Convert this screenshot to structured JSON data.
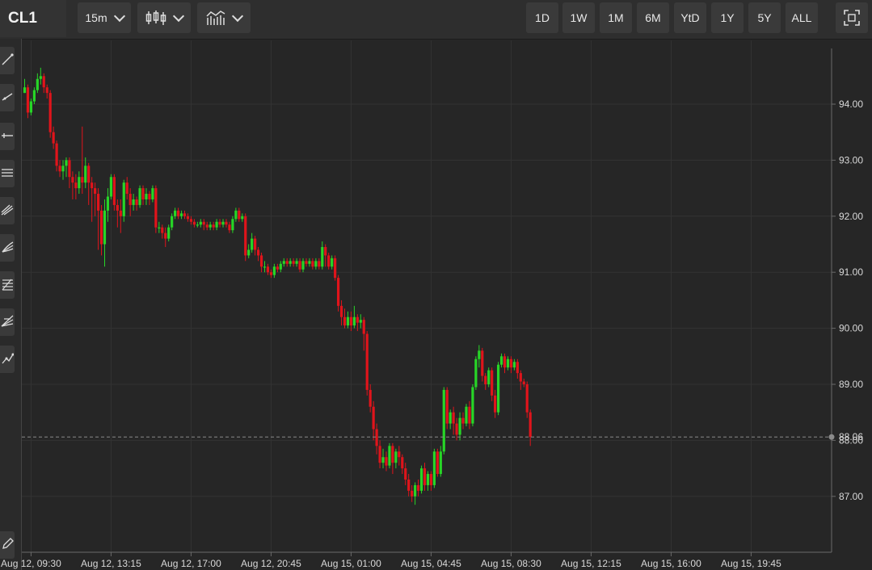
{
  "header": {
    "symbol": "CL1",
    "interval": "15m",
    "chart_type_icon": "candlestick-icon",
    "indicators_icon": "indicators-icon",
    "ranges": [
      "1D",
      "1W",
      "1M",
      "6M",
      "YtD",
      "1Y",
      "5Y",
      "ALL"
    ],
    "fullscreen_icon": "fullscreen-icon"
  },
  "sidebar": {
    "tools": [
      "trendline-icon",
      "ray-icon",
      "horizontal-line-icon",
      "parallel-channel-icon",
      "pitchfork-icon",
      "fan-icon",
      "fibonacci-icon",
      "gann-icon",
      "path-icon"
    ],
    "bottom_tool": "pencil-icon"
  },
  "price_label": "88.06",
  "colors": {
    "up": "#27d627",
    "down": "#e0141b",
    "background": "#262626",
    "grid": "#333333"
  },
  "chart_data": {
    "type": "candlestick",
    "title": "",
    "ylim": [
      86.0,
      94.95
    ],
    "y_ticks": [
      "94.00",
      "93.00",
      "92.00",
      "91.00",
      "90.00",
      "89.00",
      "88.00",
      "87.00"
    ],
    "x_ticks": [
      "Aug 12, 09:30",
      "Aug 12, 13:15",
      "Aug 12, 17:00",
      "Aug 12, 20:45",
      "Aug 15, 01:00",
      "Aug 15, 04:45",
      "Aug 15, 08:30",
      "Aug 15, 12:15",
      "Aug 15, 16:00",
      "Aug 15, 19:45"
    ],
    "x_tick_positions": [
      2,
      27,
      52,
      77,
      102,
      127,
      152,
      177,
      202,
      227
    ],
    "last_price": 88.06,
    "last_price_label": "88.06",
    "candles": [
      [
        94.2,
        94.3,
        94.45,
        94.2
      ],
      [
        94.3,
        93.85,
        94.35,
        93.75
      ],
      [
        93.85,
        94.05,
        94.1,
        93.8
      ],
      [
        94.05,
        94.25,
        94.3,
        94.0
      ],
      [
        94.25,
        94.45,
        94.55,
        94.2
      ],
      [
        94.45,
        94.5,
        94.65,
        94.35
      ],
      [
        94.5,
        94.3,
        94.55,
        94.2
      ],
      [
        94.3,
        94.2,
        94.35,
        94.1
      ],
      [
        94.2,
        93.5,
        94.25,
        93.4
      ],
      [
        93.5,
        93.3,
        93.6,
        93.2
      ],
      [
        93.3,
        92.9,
        93.35,
        92.8
      ],
      [
        92.9,
        92.8,
        93.0,
        92.7
      ],
      [
        92.8,
        92.9,
        93.0,
        92.65
      ],
      [
        92.9,
        93.0,
        93.05,
        92.7
      ],
      [
        93.0,
        92.7,
        93.05,
        92.5
      ],
      [
        92.7,
        92.6,
        92.8,
        92.3
      ],
      [
        92.6,
        92.5,
        92.75,
        92.3
      ],
      [
        92.5,
        92.7,
        92.8,
        92.4
      ],
      [
        92.7,
        92.6,
        93.6,
        92.4
      ],
      [
        92.6,
        92.9,
        93.05,
        92.5
      ],
      [
        92.9,
        92.6,
        92.95,
        92.2
      ],
      [
        92.6,
        92.5,
        92.7,
        91.9
      ],
      [
        92.5,
        92.4,
        92.6,
        92.0
      ],
      [
        92.4,
        92.1,
        92.5,
        91.4
      ],
      [
        92.1,
        91.5,
        92.2,
        91.3
      ],
      [
        91.5,
        92.1,
        92.3,
        91.1
      ],
      [
        92.1,
        92.35,
        92.5,
        91.9
      ],
      [
        92.35,
        92.7,
        92.75,
        92.3
      ],
      [
        92.7,
        92.2,
        92.75,
        92.1
      ],
      [
        92.2,
        92.1,
        92.3,
        91.8
      ],
      [
        92.1,
        92.0,
        92.3,
        91.7
      ],
      [
        92.0,
        92.6,
        92.65,
        91.9
      ],
      [
        92.6,
        92.4,
        92.7,
        92.3
      ],
      [
        92.4,
        92.2,
        92.5,
        92.0
      ],
      [
        92.2,
        92.3,
        92.4,
        92.1
      ],
      [
        92.3,
        92.2,
        92.35,
        92.1
      ],
      [
        92.2,
        92.5,
        92.55,
        92.15
      ],
      [
        92.5,
        92.3,
        92.55,
        92.2
      ],
      [
        92.3,
        92.4,
        92.5,
        92.2
      ],
      [
        92.4,
        92.3,
        92.45,
        92.2
      ],
      [
        92.3,
        92.5,
        92.55,
        92.25
      ],
      [
        92.5,
        91.8,
        92.55,
        91.7
      ],
      [
        91.8,
        91.8,
        91.9,
        91.7
      ],
      [
        91.8,
        91.7,
        91.85,
        91.6
      ],
      [
        91.7,
        91.6,
        91.8,
        91.45
      ],
      [
        91.6,
        91.8,
        91.85,
        91.55
      ],
      [
        91.8,
        92.0,
        92.05,
        91.75
      ],
      [
        92.0,
        92.1,
        92.15,
        91.95
      ],
      [
        92.1,
        92.0,
        92.15,
        91.95
      ],
      [
        92.0,
        92.05,
        92.1,
        91.95
      ],
      [
        92.05,
        92.0,
        92.1,
        91.95
      ],
      [
        92.0,
        91.95,
        92.05,
        91.9
      ],
      [
        91.95,
        91.9,
        92.0,
        91.85
      ],
      [
        91.9,
        91.85,
        91.95,
        91.8
      ],
      [
        91.85,
        91.85,
        91.9,
        91.8
      ],
      [
        91.85,
        91.9,
        91.95,
        91.8
      ],
      [
        91.9,
        91.85,
        91.95,
        91.75
      ],
      [
        91.85,
        91.8,
        91.9,
        91.75
      ],
      [
        91.8,
        91.85,
        91.9,
        91.75
      ],
      [
        91.85,
        91.8,
        91.9,
        91.75
      ],
      [
        91.8,
        91.9,
        91.95,
        91.75
      ],
      [
        91.9,
        91.85,
        91.95,
        91.8
      ],
      [
        91.85,
        91.9,
        91.95,
        91.8
      ],
      [
        91.9,
        91.85,
        91.95,
        91.8
      ],
      [
        91.85,
        91.75,
        91.9,
        91.7
      ],
      [
        91.75,
        91.95,
        92.0,
        91.7
      ],
      [
        91.95,
        92.1,
        92.15,
        91.9
      ],
      [
        92.1,
        91.95,
        92.15,
        91.9
      ],
      [
        91.95,
        92.0,
        92.05,
        91.9
      ],
      [
        92.0,
        91.3,
        92.05,
        91.2
      ],
      [
        91.3,
        91.4,
        91.5,
        91.25
      ],
      [
        91.4,
        91.6,
        91.7,
        91.35
      ],
      [
        91.6,
        91.4,
        91.65,
        91.3
      ],
      [
        91.4,
        91.3,
        91.45,
        91.2
      ],
      [
        91.3,
        91.1,
        91.35,
        91.0
      ],
      [
        91.1,
        91.1,
        91.2,
        91.0
      ],
      [
        91.1,
        91.0,
        91.15,
        90.95
      ],
      [
        91.0,
        90.95,
        91.05,
        90.9
      ],
      [
        90.95,
        91.1,
        91.15,
        90.9
      ],
      [
        91.1,
        91.05,
        91.15,
        91.0
      ],
      [
        91.05,
        91.15,
        91.2,
        91.0
      ],
      [
        91.15,
        91.2,
        91.25,
        91.1
      ],
      [
        91.2,
        91.15,
        91.25,
        91.1
      ],
      [
        91.15,
        91.2,
        91.25,
        91.1
      ],
      [
        91.2,
        91.15,
        91.25,
        91.1
      ],
      [
        91.15,
        91.2,
        91.25,
        91.1
      ],
      [
        91.2,
        91.05,
        91.25,
        91.0
      ],
      [
        91.05,
        91.2,
        91.25,
        91.0
      ],
      [
        91.2,
        91.15,
        91.25,
        91.1
      ],
      [
        91.15,
        91.2,
        91.25,
        91.1
      ],
      [
        91.2,
        91.1,
        91.25,
        91.05
      ],
      [
        91.1,
        91.2,
        91.25,
        91.05
      ],
      [
        91.2,
        91.1,
        91.25,
        91.05
      ],
      [
        91.1,
        91.45,
        91.55,
        91.05
      ],
      [
        91.45,
        91.3,
        91.5,
        91.1
      ],
      [
        91.3,
        91.1,
        91.35,
        91.05
      ],
      [
        91.1,
        91.25,
        91.3,
        91.05
      ],
      [
        91.25,
        90.9,
        91.3,
        90.85
      ],
      [
        90.9,
        90.4,
        90.95,
        90.3
      ],
      [
        90.4,
        90.2,
        90.5,
        90.05
      ],
      [
        90.2,
        90.05,
        90.35,
        90.0
      ],
      [
        90.05,
        90.2,
        90.3,
        90.0
      ],
      [
        90.2,
        90.05,
        90.3,
        89.95
      ],
      [
        90.05,
        90.2,
        90.4,
        90.0
      ],
      [
        90.2,
        90.1,
        90.25,
        89.95
      ],
      [
        90.1,
        90.15,
        90.25,
        90.0
      ],
      [
        90.15,
        89.9,
        90.2,
        89.6
      ],
      [
        89.9,
        88.9,
        89.95,
        88.8
      ],
      [
        88.9,
        88.6,
        89.0,
        88.5
      ],
      [
        88.6,
        88.2,
        88.7,
        88.0
      ],
      [
        88.2,
        87.9,
        88.3,
        87.75
      ],
      [
        87.9,
        87.6,
        88.0,
        87.5
      ],
      [
        87.6,
        87.7,
        87.85,
        87.5
      ],
      [
        87.7,
        87.55,
        87.8,
        87.45
      ],
      [
        87.55,
        87.9,
        87.95,
        87.5
      ],
      [
        87.9,
        87.6,
        87.95,
        87.4
      ],
      [
        87.6,
        87.8,
        87.85,
        87.5
      ],
      [
        87.8,
        87.7,
        87.9,
        87.55
      ],
      [
        87.7,
        87.5,
        87.75,
        87.4
      ],
      [
        87.5,
        87.3,
        87.6,
        87.2
      ],
      [
        87.3,
        87.1,
        87.4,
        87.0
      ],
      [
        87.1,
        87.0,
        87.2,
        86.9
      ],
      [
        87.0,
        87.2,
        87.25,
        86.85
      ],
      [
        87.2,
        87.1,
        87.3,
        87.0
      ],
      [
        87.1,
        87.5,
        87.55,
        87.05
      ],
      [
        87.5,
        87.2,
        87.6,
        87.1
      ],
      [
        87.2,
        87.4,
        87.45,
        87.1
      ],
      [
        87.4,
        87.2,
        87.45,
        87.1
      ],
      [
        87.2,
        87.8,
        87.85,
        87.15
      ],
      [
        87.8,
        87.4,
        87.85,
        87.35
      ],
      [
        87.4,
        87.8,
        87.9,
        87.35
      ],
      [
        87.8,
        88.9,
        88.95,
        87.75
      ],
      [
        88.9,
        88.3,
        88.95,
        88.2
      ],
      [
        88.3,
        88.5,
        88.55,
        88.2
      ],
      [
        88.5,
        88.3,
        88.6,
        88.1
      ],
      [
        88.3,
        88.1,
        88.4,
        88.0
      ],
      [
        88.1,
        88.4,
        88.5,
        88.0
      ],
      [
        88.4,
        88.3,
        88.5,
        88.2
      ],
      [
        88.3,
        88.6,
        88.65,
        88.25
      ],
      [
        88.6,
        88.3,
        88.7,
        88.2
      ],
      [
        88.3,
        88.95,
        89.0,
        88.25
      ],
      [
        88.95,
        89.45,
        89.5,
        88.9
      ],
      [
        89.45,
        89.6,
        89.7,
        89.3
      ],
      [
        89.6,
        89.15,
        89.65,
        89.05
      ],
      [
        89.15,
        89.0,
        89.2,
        88.9
      ],
      [
        89.0,
        89.25,
        89.3,
        88.95
      ],
      [
        89.25,
        88.8,
        89.3,
        88.7
      ],
      [
        88.8,
        88.5,
        88.9,
        88.4
      ],
      [
        88.5,
        89.35,
        89.4,
        88.45
      ],
      [
        89.35,
        89.5,
        89.55,
        89.3
      ],
      [
        89.5,
        89.3,
        89.55,
        89.2
      ],
      [
        89.3,
        89.45,
        89.5,
        89.25
      ],
      [
        89.45,
        89.3,
        89.5,
        89.2
      ],
      [
        89.3,
        89.4,
        89.45,
        89.25
      ],
      [
        89.4,
        89.2,
        89.45,
        89.1
      ],
      [
        89.2,
        89.05,
        89.25,
        88.9
      ],
      [
        89.05,
        89.0,
        89.1,
        88.95
      ],
      [
        89.0,
        88.5,
        89.05,
        88.4
      ],
      [
        88.5,
        88.06,
        88.55,
        87.9
      ]
    ]
  }
}
